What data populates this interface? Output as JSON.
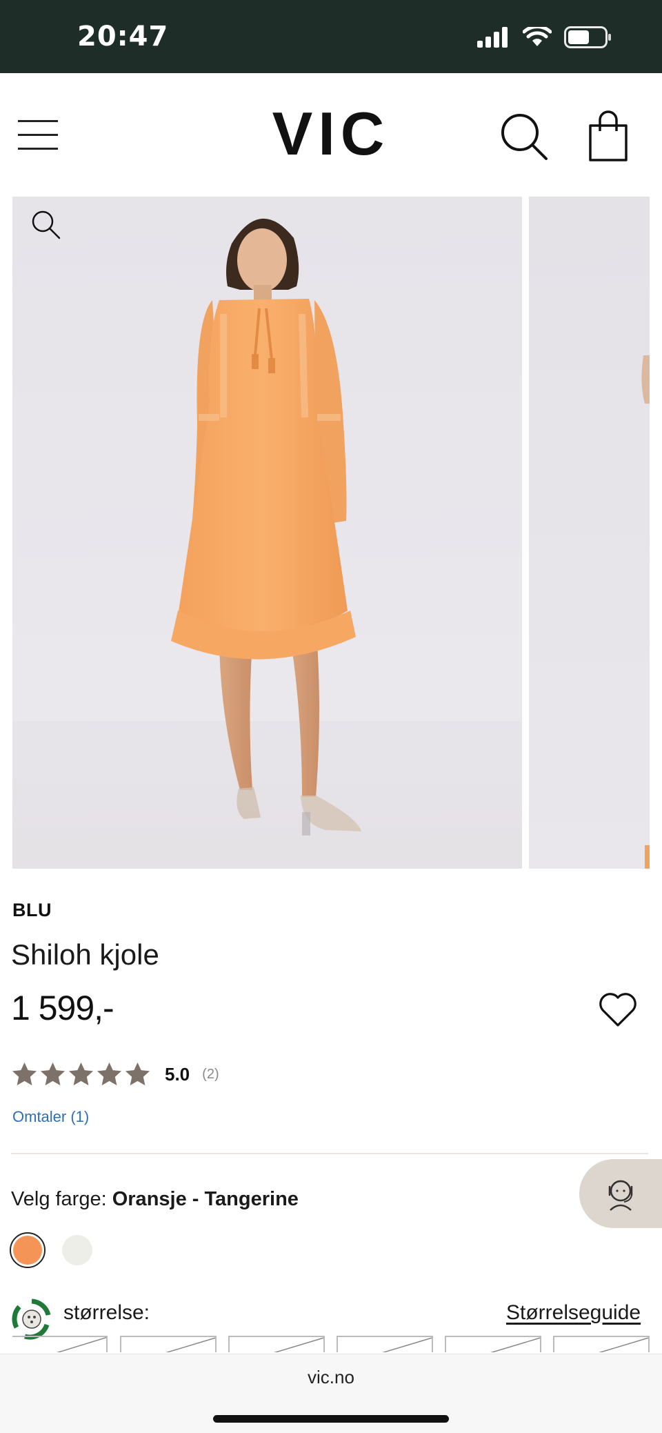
{
  "status_bar": {
    "time": "20:47"
  },
  "header": {
    "logo": "VIC"
  },
  "product": {
    "brand": "BLU",
    "name": "Shiloh kjole",
    "price": "1 599,-",
    "rating": {
      "score": "5.0",
      "count": "(2)",
      "stars": 5
    },
    "reviews_link": "Omtaler (1)"
  },
  "color": {
    "label": "Velg farge:",
    "selected": "Oransje - Tangerine",
    "swatches": [
      {
        "name": "Oransje - Tangerine",
        "hex": "#f59457",
        "selected": true
      },
      {
        "name": "white",
        "hex": "#eeeee9",
        "selected": false
      }
    ]
  },
  "size": {
    "label": "størrelse:",
    "guide_link": "Størrelseguide"
  },
  "browser": {
    "url": "vic.no"
  },
  "icons": [
    "menu-icon",
    "search-icon",
    "shopping-bag-icon",
    "zoom-icon",
    "heart-icon",
    "star-icon",
    "support-agent-icon",
    "eco-recycle-icon"
  ],
  "colors": {
    "status_bar_bg": "#1e2d27",
    "accent_link": "#2d6fb5",
    "star": "#7d726a",
    "dress_orange": "#f7a35f"
  }
}
